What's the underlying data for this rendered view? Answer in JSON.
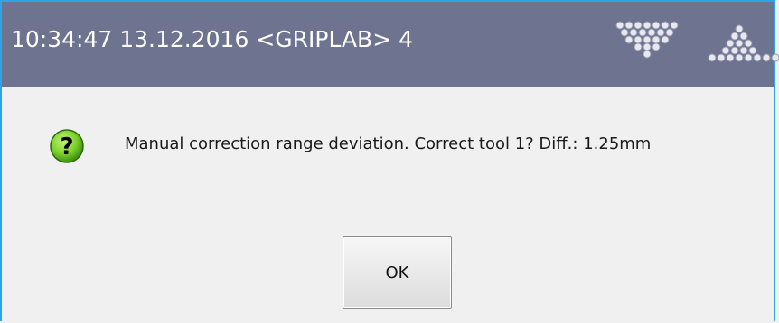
{
  "titlebar": {
    "title": "10:34:47 13.12.2016 <GRIPLAB> 4",
    "icons": [
      "dot-triangle-down-icon",
      "dot-triangle-up-icon"
    ]
  },
  "message": {
    "icon": "question-icon",
    "text": "Manual correction range deviation. Correct tool 1? Diff.: 1.25mm"
  },
  "buttons": {
    "ok_label": "OK"
  },
  "colors": {
    "titlebar_bg": "#6e7490",
    "window_border": "#2aa6e6",
    "body_bg": "#f0f0f0",
    "question_icon_green": "#7cd22a"
  }
}
